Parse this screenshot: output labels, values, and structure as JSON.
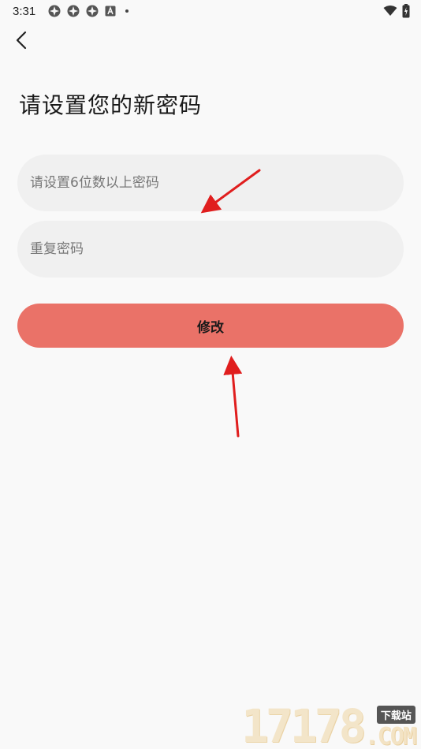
{
  "status_bar": {
    "time": "3:31",
    "left_icons": [
      "app-notification-icon",
      "app-notification-icon",
      "app-notification-icon",
      "font-a-icon",
      "dot-icon"
    ],
    "right_icons": [
      "wifi-icon",
      "battery-icon"
    ]
  },
  "header": {
    "back_icon": "chevron-left-icon",
    "title": "请设置您的新密码"
  },
  "form": {
    "password_placeholder": "请设置6位数以上密码",
    "password_value": "",
    "confirm_placeholder": "重复密码",
    "confirm_value": "",
    "submit_label": "修改"
  },
  "colors": {
    "background": "#f9f9f9",
    "field_bg": "#f0f0f0",
    "button_bg": "#ea7268",
    "annotation_arrow": "#e01e1e"
  },
  "watermark": {
    "digits": "17178",
    "badge": "下载站",
    "suffix": ".COM"
  }
}
